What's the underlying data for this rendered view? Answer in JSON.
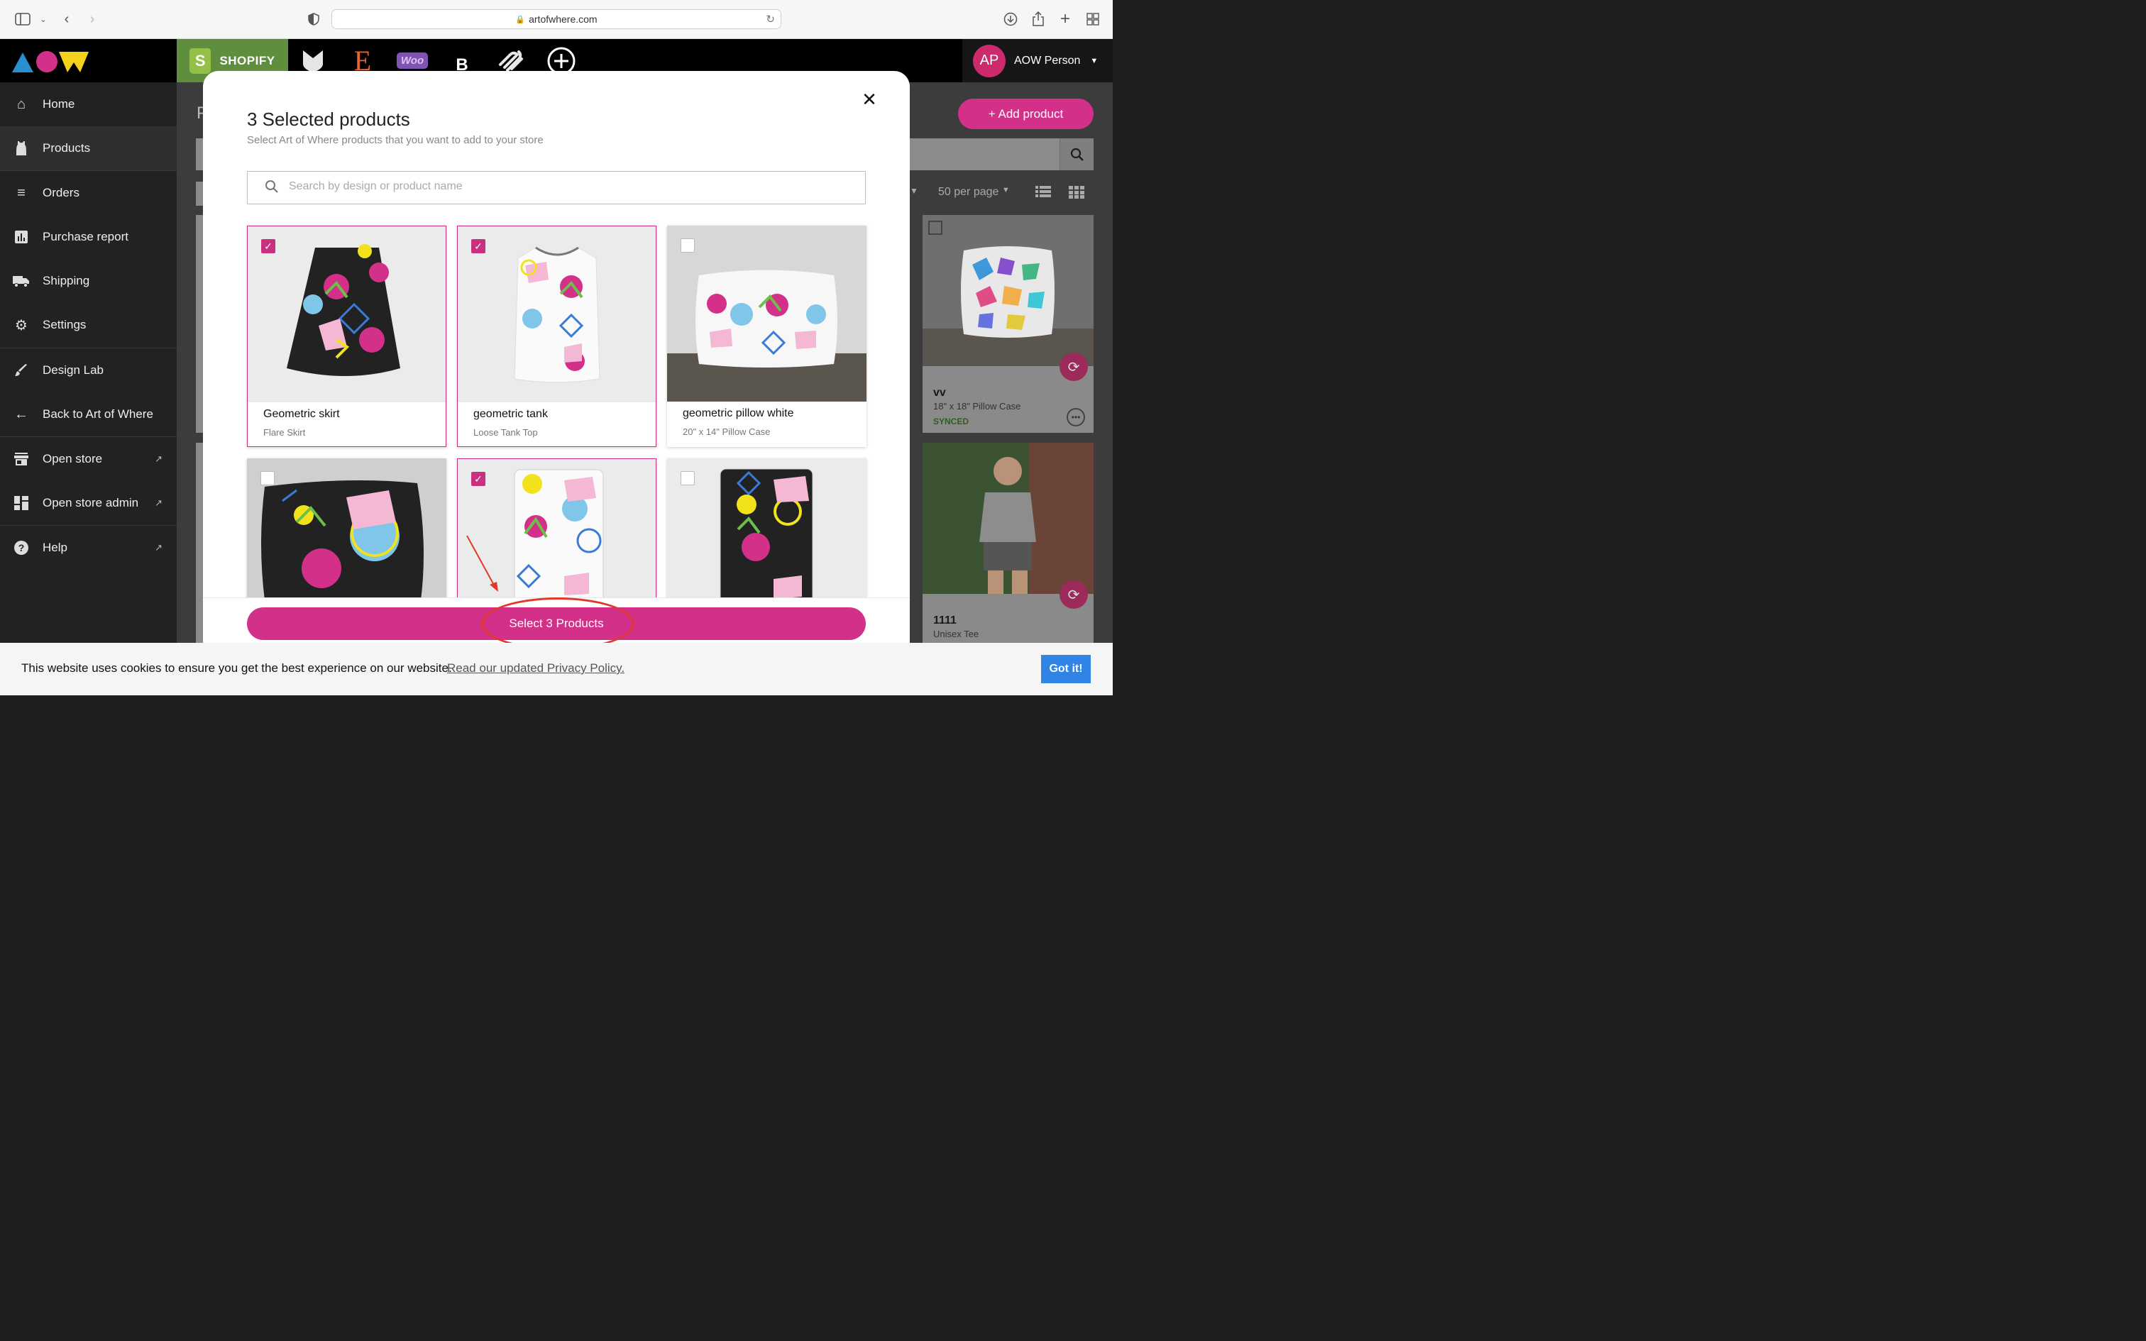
{
  "browser": {
    "url": "artofwhere.com"
  },
  "header": {
    "platforms": [
      {
        "label": "SHOPIFY",
        "icon": "shopify-icon"
      },
      {
        "icon": "bigcartel-icon"
      },
      {
        "label": "E",
        "icon": "etsy-icon"
      },
      {
        "label": "Woo",
        "icon": "woocommerce-icon"
      },
      {
        "label": "B",
        "icon": "bigcommerce-icon"
      },
      {
        "icon": "squarespace-icon"
      },
      {
        "icon": "add-platform-icon"
      }
    ],
    "user": {
      "initials": "AP",
      "name": "AOW Person"
    }
  },
  "sidebar": {
    "items": [
      {
        "label": "Home",
        "icon": "home-icon"
      },
      {
        "label": "Products",
        "icon": "tank-top-icon",
        "active": true
      },
      {
        "label": "Orders",
        "icon": "list-icon"
      },
      {
        "label": "Purchase report",
        "icon": "report-icon"
      },
      {
        "label": "Shipping",
        "icon": "truck-icon"
      },
      {
        "label": "Settings",
        "icon": "gear-icon"
      },
      {
        "label": "Design Lab",
        "icon": "brush-icon"
      },
      {
        "label": "Back to Art of Where",
        "icon": "arrow-left-icon"
      },
      {
        "label": "Open store",
        "icon": "store-icon"
      },
      {
        "label": "Open store admin",
        "icon": "dashboard-icon"
      },
      {
        "label": "Help",
        "icon": "help-icon"
      }
    ]
  },
  "background": {
    "title_fragment": "P",
    "add_product": "+ Add product",
    "per_page": "50 per page",
    "cards": [
      {
        "name": "vv",
        "type": "18\" x 18\" Pillow Case",
        "status": "SYNCED"
      },
      {
        "name": "1111",
        "type": "Unisex Tee"
      }
    ]
  },
  "modal": {
    "title": "3 Selected products",
    "subtitle": "Select Art of Where products that you want to add to your store",
    "search_placeholder": "Search by design or product name",
    "products": [
      {
        "name": "Geometric skirt",
        "type": "Flare Skirt",
        "selected": true
      },
      {
        "name": "geometric tank",
        "type": "Loose Tank Top",
        "selected": true
      },
      {
        "name": "geometric pillow white",
        "type": "20\" x 14\" Pillow Case",
        "selected": false
      },
      {
        "name": "",
        "type": "",
        "selected": false
      },
      {
        "name": "",
        "type": "",
        "selected": true
      },
      {
        "name": "",
        "type": "",
        "selected": false
      }
    ],
    "select_button": "Select 3 Products"
  },
  "cookie": {
    "text": "This website uses cookies to ensure you get the best experience on our website.",
    "link": "Read our updated Privacy Policy.",
    "button": "Got it!"
  },
  "colors": {
    "accent": "#d3308a",
    "selected_border": "#c9307f",
    "cookie_button": "#2f84e6",
    "annotation": "#e0392b"
  }
}
